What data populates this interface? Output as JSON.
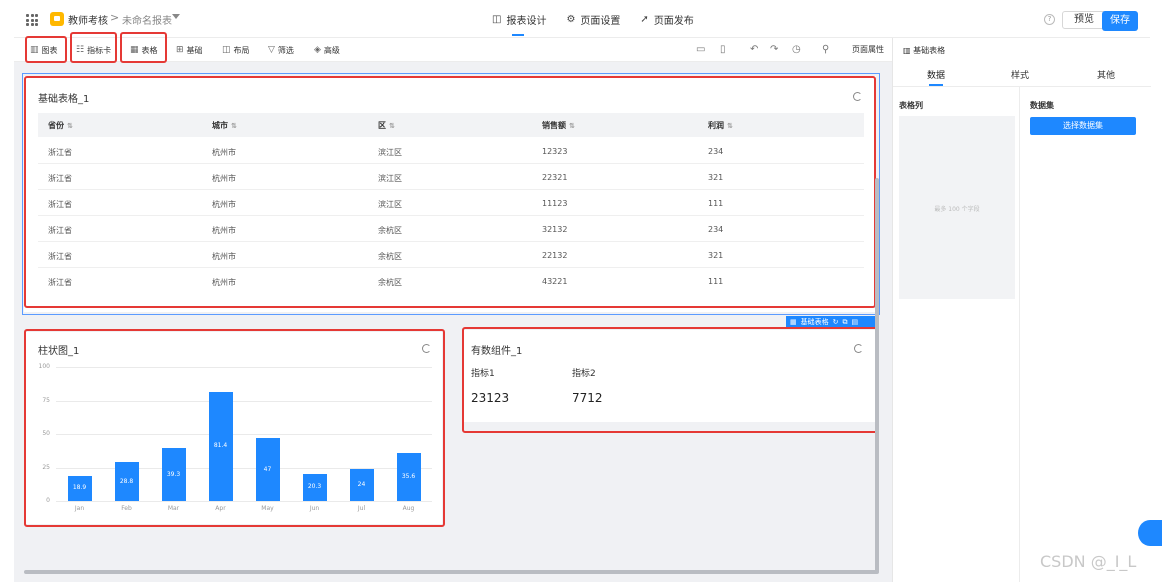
{
  "header": {
    "app_name": "教师考核",
    "breadcrumb_sep": ">",
    "report_name": "未命名报表",
    "tabs": [
      {
        "label": "报表设计",
        "icon": "◫"
      },
      {
        "label": "页面设置",
        "icon": "⚙"
      },
      {
        "label": "页面发布",
        "icon": "➚"
      }
    ],
    "help_icon": "?",
    "preview_label": "预览",
    "save_label": "保存"
  },
  "toolbar": {
    "items": [
      {
        "label": "图表",
        "icon": "▥"
      },
      {
        "label": "指标卡",
        "icon": "☷"
      },
      {
        "label": "表格",
        "icon": "▦"
      },
      {
        "label": "基础",
        "icon": "⊞"
      },
      {
        "label": "布局",
        "icon": "◫"
      },
      {
        "label": "筛选",
        "icon": "▽"
      },
      {
        "label": "高级",
        "icon": "◈"
      }
    ],
    "right_icons": [
      "▭",
      "▯",
      "↶",
      "↷",
      "◷",
      "⚲"
    ],
    "page_props_label": "页面属性"
  },
  "table_card": {
    "title": "基础表格_1",
    "columns": [
      "省份",
      "城市",
      "区",
      "销售额",
      "利润"
    ],
    "rows": [
      [
        "浙江省",
        "杭州市",
        "滨江区",
        "12323",
        "234"
      ],
      [
        "浙江省",
        "杭州市",
        "滨江区",
        "22321",
        "321"
      ],
      [
        "浙江省",
        "杭州市",
        "滨江区",
        "11123",
        "111"
      ],
      [
        "浙江省",
        "杭州市",
        "余杭区",
        "32132",
        "234"
      ],
      [
        "浙江省",
        "杭州市",
        "余杭区",
        "22132",
        "321"
      ],
      [
        "浙江省",
        "杭州市",
        "余杭区",
        "43221",
        "111"
      ]
    ],
    "selection_label": "基础表格"
  },
  "chart_card": {
    "title": "柱状图_1"
  },
  "chart_data": {
    "type": "bar",
    "categories": [
      "Jan",
      "Feb",
      "Mar",
      "Apr",
      "May",
      "Jun",
      "Jul",
      "Aug"
    ],
    "values": [
      18.9,
      28.8,
      39.3,
      81.4,
      47,
      20.3,
      24,
      35.6
    ],
    "value_labels": [
      "18.9",
      "28.8",
      "39.3",
      "81.4",
      "47",
      "20.3",
      "24",
      "35.6"
    ],
    "yticks": [
      "0",
      "25",
      "50",
      "75",
      "100"
    ],
    "ylim": [
      0,
      100
    ],
    "color": "#1e88ff",
    "grid": true
  },
  "metric_card": {
    "title": "有数组件_1",
    "metrics": [
      {
        "label": "指标1",
        "value": "23123"
      },
      {
        "label": "指标2",
        "value": "7712"
      }
    ]
  },
  "right_panel": {
    "title": "基础表格",
    "tabs": [
      "数据",
      "样式",
      "其他"
    ],
    "columns_section": "表格列",
    "field_hint": "最多 100 个字段",
    "dataset_section": "数据集",
    "dataset_button": "选择数据集"
  },
  "watermark": "CSDN @_I_L",
  "colors": {
    "accent": "#1e88ff",
    "highlight": "#e53935",
    "canvas": "#f0f1f4"
  }
}
